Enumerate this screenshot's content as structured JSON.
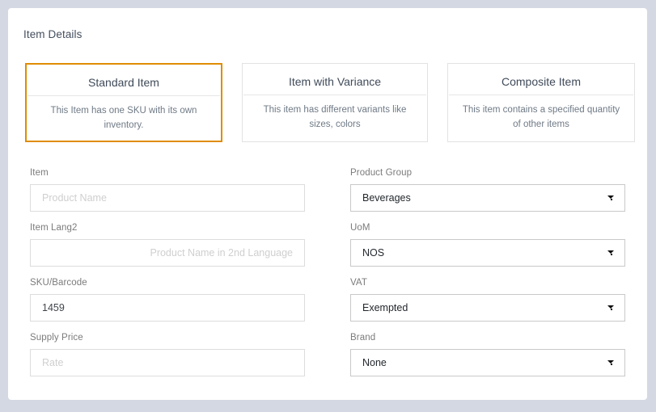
{
  "page": {
    "background_color": "#d4d8e2",
    "panel_background": "#ffffff"
  },
  "panel": {
    "title": "Item Details"
  },
  "item_types": {
    "selected_index": 0,
    "selected_border_color": "#df8c03",
    "cards": [
      {
        "title": "Standard Item",
        "description": "This Item has one SKU with its own inventory.",
        "selected": true
      },
      {
        "title": "Item with Variance",
        "description": "This item has different variants like sizes, colors",
        "selected": false
      },
      {
        "title": "Composite Item",
        "description": "This item contains a specified quantity of other items",
        "selected": false
      }
    ]
  },
  "form": {
    "left_column": [
      {
        "label": "Item",
        "type": "text",
        "value": "",
        "placeholder": "Product Name",
        "align": "left"
      },
      {
        "label": "Item Lang2",
        "type": "text",
        "value": "",
        "placeholder": "Product Name in 2nd Language",
        "align": "right"
      },
      {
        "label": "SKU/Barcode",
        "type": "text",
        "value": "1459",
        "placeholder": "",
        "align": "left"
      },
      {
        "label": "Supply Price",
        "type": "text",
        "value": "",
        "placeholder": "Rate",
        "align": "left"
      }
    ],
    "right_column": [
      {
        "label": "Product Group",
        "type": "select",
        "value": "Beverages",
        "caret": "chevron-down-icon"
      },
      {
        "label": "UoM",
        "type": "select",
        "value": "NOS",
        "caret": "chevron-down-icon"
      },
      {
        "label": "VAT",
        "type": "select",
        "value": "Exempted",
        "caret": "chevron-down-icon"
      },
      {
        "label": "Brand",
        "type": "select",
        "value": "None",
        "caret": "chevron-down-icon"
      }
    ]
  }
}
